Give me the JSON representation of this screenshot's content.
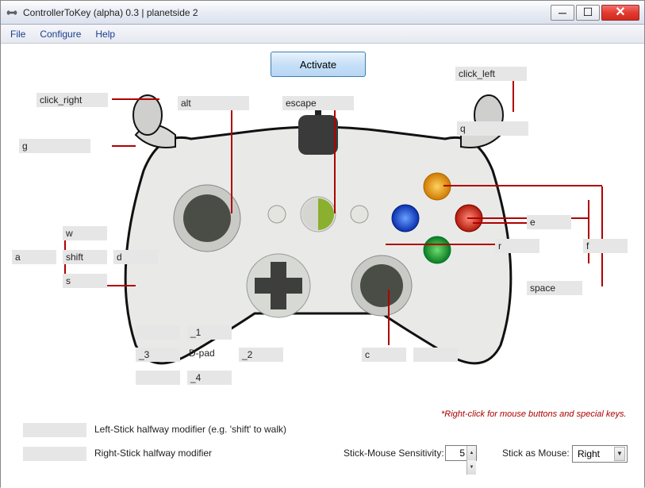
{
  "window": {
    "title": "ControllerToKey (alpha) 0.3 | planetside 2"
  },
  "menu": {
    "file": "File",
    "configure": "Configure",
    "help": "Help"
  },
  "activate": "Activate",
  "maps": {
    "lt": "click_right",
    "rt": "click_left",
    "lb": "g",
    "rb": "q",
    "back": "alt",
    "start": "escape",
    "ls_up": "w",
    "ls_down": "s",
    "ls_left": "a",
    "ls_right": "d",
    "ls_click": "shift",
    "dpad_up": "_1",
    "dpad_down": "_4",
    "dpad_left": "_3",
    "dpad_right": "_2",
    "dpad_center": "D-pad",
    "rs_click": "c",
    "btn_a": "space",
    "btn_b": "f",
    "btn_x": "r",
    "btn_y": "e",
    "rs_extra": "",
    "ls_half": "",
    "rs_half": "",
    "dpad_empty1": "",
    "dpad_empty2": ""
  },
  "labels": {
    "ls_half": "Left-Stick halfway modifier (e.g. 'shift' to walk)",
    "rs_half": "Right-Stick halfway modifier",
    "hint": "*Right-click for mouse buttons and special keys.",
    "sens": "Stick-Mouse Sensitivity:",
    "stick_as_mouse": "Stick as Mouse:"
  },
  "sensitivity": "5",
  "stick_mouse": "Right"
}
